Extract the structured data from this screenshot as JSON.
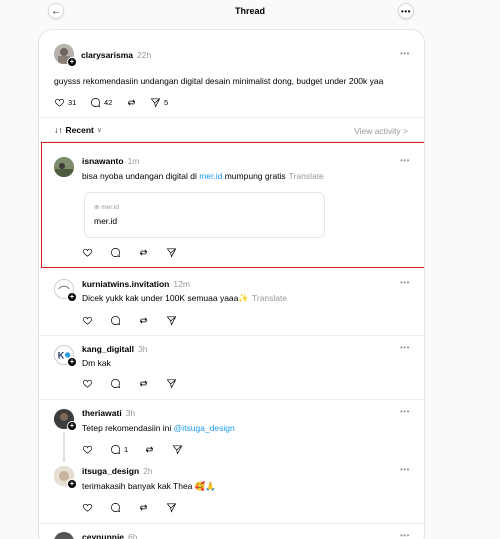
{
  "header": {
    "title": "Thread",
    "back_icon": "←",
    "more_icon": "•••"
  },
  "main_post": {
    "username": "clarysarisma",
    "time": "22h",
    "text": "guysss rekomendasiin undangan digital desain minimalist dong, budget under 200k yaa",
    "likes": "31",
    "replies": "42",
    "shares": "5"
  },
  "sort": {
    "label": "Recent",
    "icon": "↓↑",
    "chevron": "∨",
    "view_activity": "View activity >"
  },
  "replies": [
    {
      "username": "isnawanto",
      "time": "1m",
      "text_before": "bisa nyoba undangan digital di ",
      "link": "mer.id",
      "text_after": " mumpung gratis",
      "translate": "Translate",
      "card_domain": "mer.id",
      "card_title": "mer.id"
    },
    {
      "username": "kurniatwins.invitation",
      "time": "12m",
      "text": "Dicek yukk kak under 100K semuaa yaaa✨",
      "translate": "Translate"
    },
    {
      "username": "kang_digitall",
      "time": "3h",
      "text": "Dm kak"
    },
    {
      "username": "theriawati",
      "time": "3h",
      "text_before": "Tetep rekomendasiin ini ",
      "mention": "@itsuga_design",
      "reply_count": "1"
    },
    {
      "username": "itsuga_design",
      "time": "2h",
      "text": "terimakasih banyak kak Thea 🥰🙏"
    },
    {
      "username": "ceynunnie",
      "time": "6h"
    }
  ],
  "colors": {
    "link": "#1d9bf0",
    "highlight": "#e01e1e"
  }
}
